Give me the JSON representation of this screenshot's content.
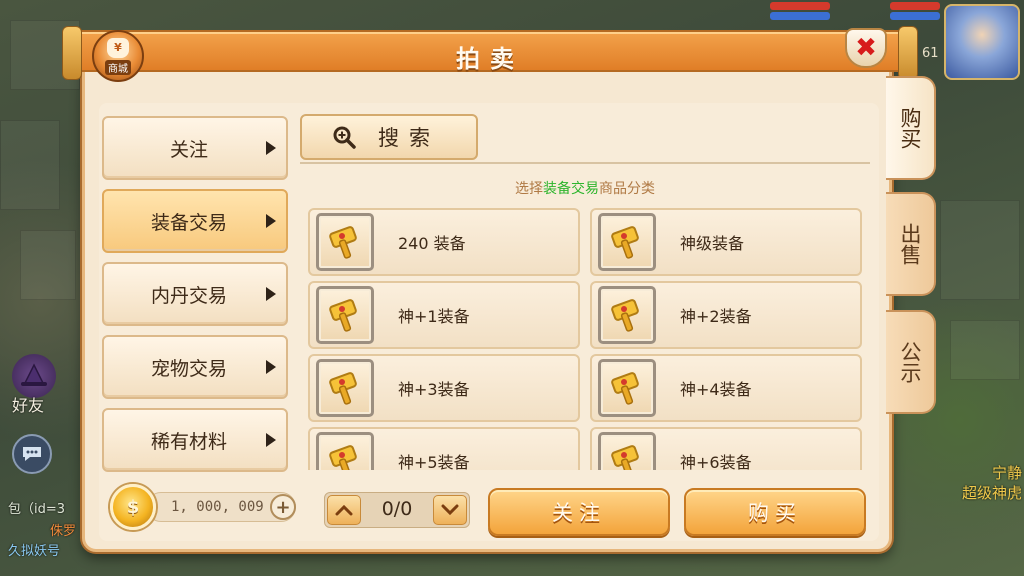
{
  "hud": {
    "player_level": "61",
    "friend_label": "好友",
    "chat_prefix": "包（id=3",
    "chat_name": "侏罗",
    "chat_line2": "久拟妖号",
    "npc_title": "宁静",
    "npc_name": "超级神虎"
  },
  "panel": {
    "title": "拍卖",
    "shop_badge_label": "商城",
    "shop_badge_symbol": "¥",
    "close_symbol": "✖"
  },
  "side_tabs": [
    {
      "label": "购买",
      "active": true
    },
    {
      "label": "出售",
      "active": false
    },
    {
      "label": "公示",
      "active": false
    }
  ],
  "categories": [
    {
      "label": "关注",
      "active": false
    },
    {
      "label": "装备交易",
      "active": true
    },
    {
      "label": "内丹交易",
      "active": false
    },
    {
      "label": "宠物交易",
      "active": false
    },
    {
      "label": "稀有材料",
      "active": false
    }
  ],
  "search": {
    "label": "搜索"
  },
  "hint": {
    "prefix": "选择",
    "highlight": "装备交易",
    "suffix": "商品分类"
  },
  "items": [
    {
      "name": "240  装备"
    },
    {
      "name": "神级装备"
    },
    {
      "name": "神+1装备"
    },
    {
      "name": "神+2装备"
    },
    {
      "name": "神+3装备"
    },
    {
      "name": "神+4装备"
    },
    {
      "name": "神+5装备"
    },
    {
      "name": "神+6装备"
    }
  ],
  "footer": {
    "currency_symbol": "$",
    "money": "1, 000, 009",
    "plus_symbol": "+",
    "page": "0/0",
    "watch_button": "关注",
    "buy_button": "购买"
  },
  "colors": {
    "accent_orange": "#f3a24b",
    "highlight_green": "#2db52d",
    "close_red": "#d71b1b"
  }
}
